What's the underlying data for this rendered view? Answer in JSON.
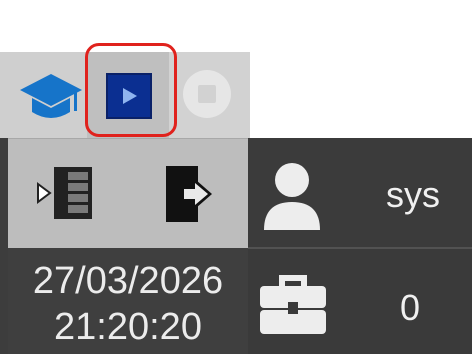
{
  "toolbar": {
    "left_icon": "graduation-cap-icon",
    "play_icon": "play-icon",
    "stop_icon": "stop-icon",
    "accent_color": "#0b2f91",
    "focus_color": "#e0221d"
  },
  "nav": {
    "sidebar_icon": "sidebar-list-icon",
    "exit_icon": "exit-icon"
  },
  "status": {
    "date": "27/03/2026",
    "time": "21:20:20",
    "user_icon": "user-icon",
    "user": "sys",
    "briefcase_icon": "briefcase-icon",
    "count": "0"
  }
}
